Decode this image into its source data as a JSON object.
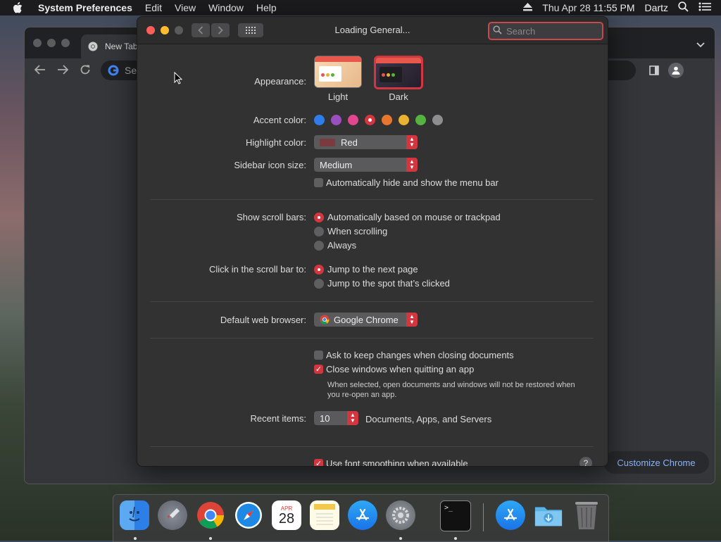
{
  "menubar": {
    "app_name": "System Preferences",
    "menus": [
      "Edit",
      "View",
      "Window",
      "Help"
    ],
    "datetime": "Thu Apr 28  11:55 PM",
    "user": "Dartz"
  },
  "chrome": {
    "tab_title": "New Tab",
    "omnibox_placeholder": "Se",
    "customize_label": "Customize Chrome"
  },
  "prefs": {
    "window_title": "Loading General...",
    "search_placeholder": "Search",
    "appearance": {
      "label": "Appearance:",
      "options": [
        "Light",
        "Dark"
      ],
      "selected": "Dark"
    },
    "accent": {
      "label": "Accent color:",
      "colors": [
        "#2f7ded",
        "#9b4fbf",
        "#e3468f",
        "#d2363f",
        "#e8772e",
        "#e9b230",
        "#55b440",
        "#8e8e90"
      ],
      "selected_index": 3
    },
    "highlight": {
      "label": "Highlight color:",
      "value": "Red",
      "swatch": "#7a3b3e"
    },
    "sidebar_icon": {
      "label": "Sidebar icon size:",
      "value": "Medium"
    },
    "auto_hide_menubar": {
      "label": "Automatically hide and show the menu bar",
      "checked": false
    },
    "scroll_bars": {
      "label": "Show scroll bars:",
      "options": [
        "Automatically based on mouse or trackpad",
        "When scrolling",
        "Always"
      ],
      "selected_index": 0
    },
    "click_scroll": {
      "label": "Click in the scroll bar to:",
      "options": [
        "Jump to the next page",
        "Jump to the spot that’s clicked"
      ],
      "selected_index": 0
    },
    "browser": {
      "label": "Default web browser:",
      "value": "Google Chrome"
    },
    "ask_keep_changes": {
      "label": "Ask to keep changes when closing documents",
      "checked": false
    },
    "close_windows": {
      "label": "Close windows when quitting an app",
      "checked": true
    },
    "close_windows_note": "When selected, open documents and windows will not be restored when you re-open an app.",
    "recent": {
      "label": "Recent items:",
      "value": "10",
      "suffix": "Documents, Apps, and Servers"
    },
    "font_smoothing": {
      "label": "Use font smoothing when available",
      "checked": true
    },
    "help_label": "?"
  },
  "dock": {
    "calendar_month": "APR",
    "calendar_day": "28",
    "terminal_prompt": ">_",
    "items": [
      "finder-icon",
      "launchpad-icon",
      "chrome-icon",
      "safari-icon",
      "calendar-icon",
      "notes-icon",
      "app-store-icon",
      "system-preferences-icon",
      "terminal-icon",
      "app-store-folder-icon",
      "downloads-folder-icon",
      "trash-icon"
    ]
  }
}
